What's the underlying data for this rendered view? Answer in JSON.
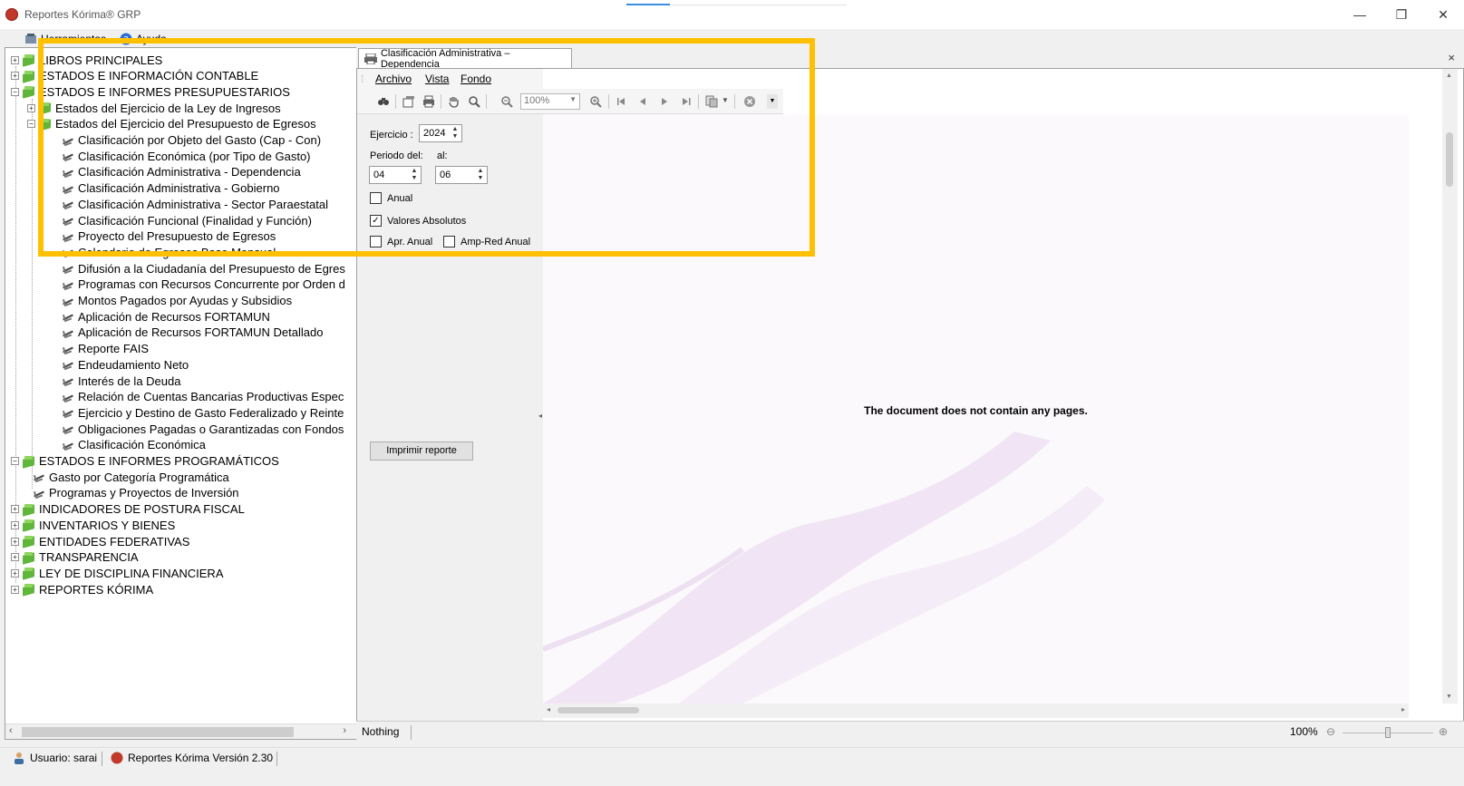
{
  "window": {
    "title": "Reportes Kórima® GRP",
    "controls": [
      "—",
      "❐",
      "✕"
    ]
  },
  "menubar": {
    "herramientas": "Herramientas",
    "ayuda": "Ayuda"
  },
  "tree": {
    "items": [
      {
        "label": "LIBROS PRINCIPALES",
        "level": 0,
        "type": "folder",
        "expander": "+"
      },
      {
        "label": "ESTADOS E INFORMACIÓN CONTABLE",
        "level": 0,
        "type": "folder",
        "expander": "+"
      },
      {
        "label": "ESTADOS E INFORMES PRESUPUESTARIOS",
        "level": 0,
        "type": "folder",
        "expander": "−"
      },
      {
        "label": "Estados del Ejercicio de la Ley de Ingresos",
        "level": 1,
        "type": "folder",
        "expander": "+"
      },
      {
        "label": "Estados del Ejercicio del Presupuesto de Egresos",
        "level": 1,
        "type": "folder",
        "expander": "−"
      },
      {
        "label": "Clasificación por Objeto del Gasto (Cap -  Con)",
        "level": 2,
        "type": "leaf"
      },
      {
        "label": "Clasificación Económica (por Tipo de Gasto)",
        "level": 2,
        "type": "leaf"
      },
      {
        "label": "Clasificación Administrativa - Dependencia",
        "level": 2,
        "type": "leaf"
      },
      {
        "label": "Clasificación Administrativa - Gobierno",
        "level": 2,
        "type": "leaf"
      },
      {
        "label": "Clasificación Administrativa - Sector Paraestatal",
        "level": 2,
        "type": "leaf"
      },
      {
        "label": "Clasificación Funcional (Finalidad y Función)",
        "level": 2,
        "type": "leaf"
      },
      {
        "label": "Proyecto del Presupuesto de Egresos",
        "level": 2,
        "type": "leaf"
      },
      {
        "label": "Calendario de Egresos Base Mensual",
        "level": 2,
        "type": "leaf"
      },
      {
        "label": "Difusión a la Ciudadanía del Presupuesto de Egres",
        "level": 2,
        "type": "leaf"
      },
      {
        "label": "Programas con Recursos Concurrente por Orden d",
        "level": 2,
        "type": "leaf"
      },
      {
        "label": "Montos Pagados por Ayudas y Subsidios",
        "level": 2,
        "type": "leaf"
      },
      {
        "label": "Aplicación de Recursos FORTAMUN",
        "level": 2,
        "type": "leaf"
      },
      {
        "label": "Aplicación de Recursos FORTAMUN Detallado",
        "level": 2,
        "type": "leaf"
      },
      {
        "label": "Reporte FAIS",
        "level": 2,
        "type": "leaf"
      },
      {
        "label": "Endeudamiento Neto",
        "level": 2,
        "type": "leaf"
      },
      {
        "label": "Interés de la Deuda",
        "level": 2,
        "type": "leaf"
      },
      {
        "label": "Relación de Cuentas Bancarias Productivas Espec",
        "level": 2,
        "type": "leaf"
      },
      {
        "label": "Ejercicio y Destino de Gasto Federalizado y Reinte",
        "level": 2,
        "type": "leaf"
      },
      {
        "label": "Obligaciones Pagadas o Garantizadas con Fondos",
        "level": 2,
        "type": "leaf"
      },
      {
        "label": "Clasificación Económica",
        "level": 2,
        "type": "leaf"
      },
      {
        "label": "ESTADOS E INFORMES PROGRAMÁTICOS",
        "level": 0,
        "type": "folder",
        "expander": "−"
      },
      {
        "label": "Gasto por Categoría Programática",
        "level": 1,
        "type": "leaf"
      },
      {
        "label": "Programas y Proyectos de Inversión",
        "level": 1,
        "type": "leaf"
      },
      {
        "label": "INDICADORES DE POSTURA FISCAL",
        "level": 0,
        "type": "folder",
        "expander": "+"
      },
      {
        "label": "INVENTARIOS Y BIENES",
        "level": 0,
        "type": "folder",
        "expander": "+"
      },
      {
        "label": "ENTIDADES FEDERATIVAS",
        "level": 0,
        "type": "folder",
        "expander": "+"
      },
      {
        "label": "TRANSPARENCIA",
        "level": 0,
        "type": "folder",
        "expander": "+"
      },
      {
        "label": "LEY DE DISCIPLINA FINANCIERA",
        "level": 0,
        "type": "folder",
        "expander": "+"
      },
      {
        "label": "REPORTES KÓRIMA",
        "level": 0,
        "type": "folder",
        "expander": "+"
      }
    ]
  },
  "doc_tab": {
    "title": "Clasificación Administrativa – Dependencia",
    "close": "×"
  },
  "doc_menu": {
    "archivo": "Archivo",
    "vista": "Vista",
    "fondo": "Fondo"
  },
  "toolbar": {
    "zoom": "100%"
  },
  "params": {
    "ejercicio_label": "Ejercicio :",
    "ejercicio_value": "2024",
    "periodo_del_label": "Periodo del:",
    "al_label": "al:",
    "periodo_del_value": "04",
    "al_value": "06",
    "anual_label": "Anual",
    "anual_checked": false,
    "valores_absolutos_label": "Valores Absolutos",
    "valores_absolutos_checked": true,
    "apr_anual_label": "Apr. Anual",
    "apr_anual_checked": false,
    "amp_red_anual_label": "Amp-Red Anual",
    "amp_red_anual_checked": false,
    "print_button": "Imprimir reporte"
  },
  "preview": {
    "message": "The document does not contain any pages."
  },
  "preview_status": {
    "text": "Nothing",
    "zoom": "100%"
  },
  "statusbar": {
    "user": "Usuario: sarai",
    "version": "Reportes Kórima Versión 2.30"
  },
  "colors": {
    "highlight": "#ffc000",
    "folder_green": "#5fb63a"
  }
}
